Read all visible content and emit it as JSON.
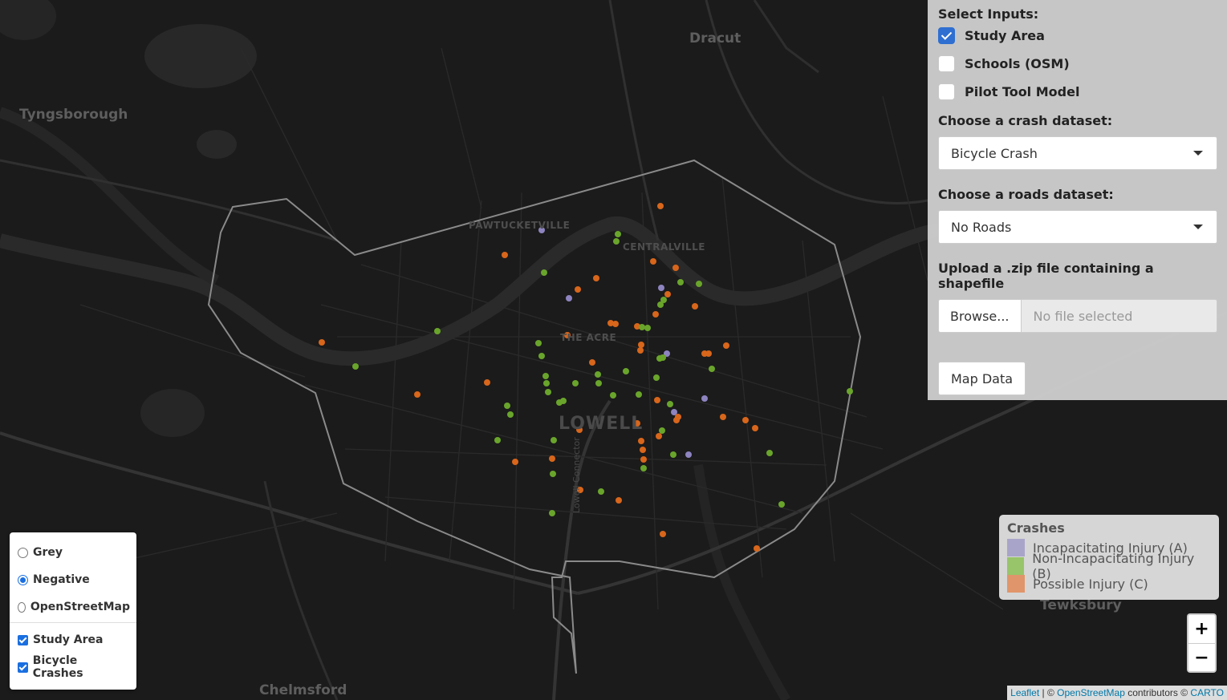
{
  "map": {
    "places": {
      "dracut": "Dracut",
      "tyngsborough": "Tyngsborough",
      "pawtucketville": "PAWTUCKETVILLE",
      "centralville": "CENTRALVILLE",
      "the_acre": "THE ACRE",
      "lowell": "LOWELL",
      "chelmsford": "Chelmsford",
      "tewksbury": "Tewksbury",
      "lowell_connector": "Lowell Connector"
    },
    "colors": {
      "background": "#1b1b1b",
      "study_area_outline": "#8a8a8a",
      "incapacitating": "#8e84c0",
      "non_incapacitating": "#6aa52b",
      "possible": "#d8661b"
    }
  },
  "panel": {
    "select_inputs_label": "Select Inputs:",
    "inputs": [
      {
        "label": "Study Area",
        "checked": true
      },
      {
        "label": "Schools (OSM)",
        "checked": false
      },
      {
        "label": "Pilot Tool Model",
        "checked": false
      }
    ],
    "crash_label": "Choose a crash dataset:",
    "crash_value": "Bicycle Crash",
    "roads_label": "Choose a roads dataset:",
    "roads_value": "No Roads",
    "upload_label": "Upload a .zip file containing a shapefile",
    "browse_label": "Browse...",
    "file_placeholder": "No file selected",
    "map_data_label": "Map Data"
  },
  "layers": {
    "basemaps": [
      {
        "label": "Grey",
        "selected": false
      },
      {
        "label": "Negative",
        "selected": true
      },
      {
        "label": "OpenStreetMap",
        "selected": false
      }
    ],
    "overlays": [
      {
        "label": "Study Area",
        "checked": true
      },
      {
        "label": "Bicycle Crashes",
        "checked": true
      }
    ]
  },
  "legend": {
    "title": "Crashes",
    "items": [
      {
        "label": "Incapacitating Injury (A)",
        "color": "#a8a4c9"
      },
      {
        "label": "Non-Incapacitating Injury (B)",
        "color": "#98c46a"
      },
      {
        "label": "Possible Injury (C)",
        "color": "#e0956a"
      }
    ]
  },
  "zoom": {
    "in": "+",
    "out": "−"
  },
  "attribution": {
    "leaflet": "Leaflet",
    "sep": " | © ",
    "osm": "OpenStreetMap",
    "contrib": " contributors © ",
    "carto": "CARTO"
  }
}
